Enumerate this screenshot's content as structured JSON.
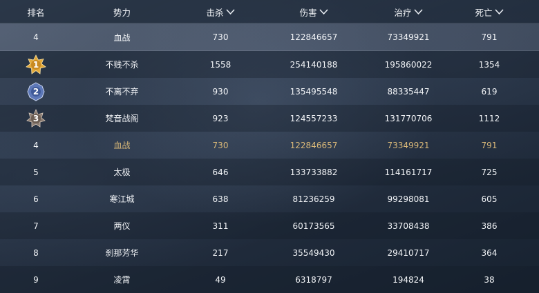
{
  "columns": {
    "rank": "排名",
    "faction": "势力",
    "kills": "击杀",
    "damage": "伤害",
    "healing": "治疗",
    "deaths": "死亡"
  },
  "my_row": {
    "rank": "4",
    "faction": "血战",
    "kills": "730",
    "damage": "122846657",
    "healing": "73349921",
    "deaths": "791"
  },
  "rows": [
    {
      "rank": "1",
      "medal": "gold",
      "faction": "不贱不杀",
      "kills": "1558",
      "damage": "254140188",
      "healing": "195860022",
      "deaths": "1354"
    },
    {
      "rank": "2",
      "medal": "silver",
      "faction": "不离不弃",
      "kills": "930",
      "damage": "135495548",
      "healing": "88335447",
      "deaths": "619"
    },
    {
      "rank": "3",
      "medal": "bronze",
      "faction": "梵音战阁",
      "kills": "923",
      "damage": "124557233",
      "healing": "131770706",
      "deaths": "1112"
    },
    {
      "rank": "4",
      "faction": "血战",
      "kills": "730",
      "damage": "122846657",
      "healing": "73349921",
      "deaths": "791"
    },
    {
      "rank": "5",
      "faction": "太极",
      "kills": "646",
      "damage": "133733882",
      "healing": "114161717",
      "deaths": "725"
    },
    {
      "rank": "6",
      "faction": "寒江城",
      "kills": "638",
      "damage": "81236259",
      "healing": "99298081",
      "deaths": "605"
    },
    {
      "rank": "7",
      "faction": "两仪",
      "kills": "311",
      "damage": "60173565",
      "healing": "33708438",
      "deaths": "386"
    },
    {
      "rank": "8",
      "faction": "刹那芳华",
      "kills": "217",
      "damage": "35549430",
      "healing": "29410717",
      "deaths": "364"
    },
    {
      "rank": "9",
      "faction": "凌霄",
      "kills": "49",
      "damage": "6318797",
      "healing": "194824",
      "deaths": "38"
    }
  ],
  "colors": {
    "highlight_text": "#d9b878",
    "gold_medal": "#e3a93a",
    "silver_medal": "#5d78b8",
    "bronze_medal": "#8a7c72"
  }
}
